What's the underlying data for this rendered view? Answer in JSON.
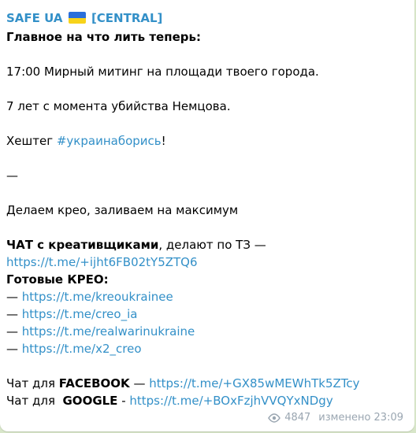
{
  "post": {
    "channel_title": "SAFE UA",
    "channel_tag": "[CENTRAL]",
    "heading": "Главное на что лить теперь:",
    "line_meeting": "17:00 Мирный митинг на площади твоего города.",
    "line_nemtsov": "7 лет с момента убийства Немцова.",
    "hashtag_prefix": "Хештег ",
    "hashtag": "#украинаборись",
    "hashtag_suffix": "!",
    "dash": "—",
    "line_creo": "Делаем крео, заливаем на максимум",
    "chat_creatives_bold": "ЧАТ с креативщиками",
    "chat_creatives_rest": ", делают по ТЗ —",
    "chat_creatives_link": "https://t.me/+ijht6FB02tY5ZTQ6",
    "ready_creo_heading": "Готовые КРЕО:",
    "creo_links": [
      "https://t.me/kreoukrainee",
      "https://t.me/creo_ia",
      "https://t.me/realwarinukraine",
      "https://t.me/x2_creo"
    ],
    "fb_prefix": "Чат для ",
    "fb_bold": "FACEBOOK",
    "fb_sep": " — ",
    "fb_link": "https://t.me/+GX85wMEWhTk5ZTcy",
    "google_prefix": "Чат для  ",
    "google_bold": "GOOGLE",
    "google_sep": " - ",
    "google_link": "https://t.me/+BOxFzjhVVQYxNDgy"
  },
  "footer": {
    "views": "4847",
    "edited_label": "изменено 23:09"
  },
  "colors": {
    "link": "#3390c8",
    "meta": "#9aa6b1",
    "flag_blue": "#2a6fdb",
    "flag_yellow": "#f7d31a"
  },
  "icons": {
    "views": "eye-icon",
    "flag": "ukraine-flag-icon"
  }
}
